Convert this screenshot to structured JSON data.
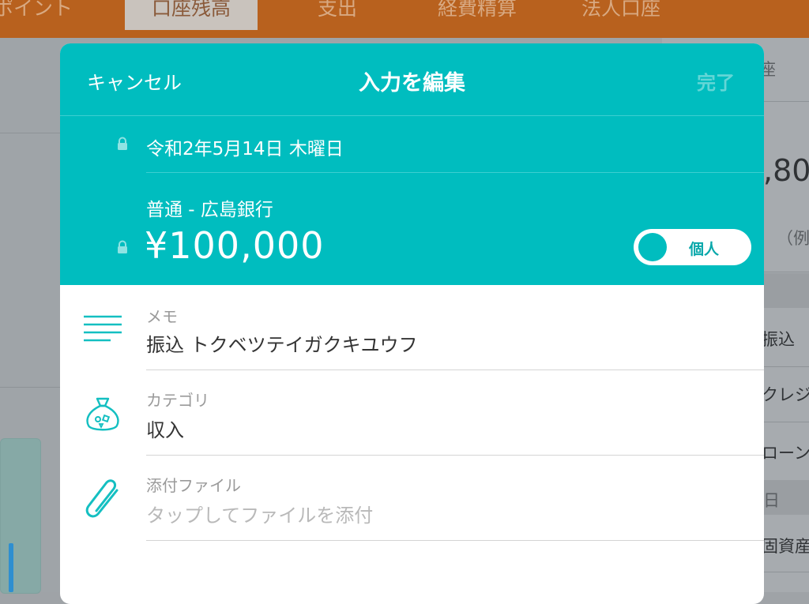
{
  "background": {
    "tabs": [
      "ポイント",
      "口座残高",
      "支出",
      "経費精算",
      "法人口座"
    ],
    "selected_tab": "口座残高",
    "right_panel": {
      "header_fragment": "座",
      "amount_fragment": ",80",
      "hint_fragment": "（例",
      "list_items": [
        "振込",
        "クレジ",
        "ローン"
      ],
      "section_fragment": "日",
      "footer_fragment": "固資産"
    }
  },
  "modal": {
    "cancel_label": "キャンセル",
    "title": "入力を編集",
    "done_label": "完了",
    "date": "令和2年5月14日 木曜日",
    "account": "普通 - 広島銀行",
    "amount": "¥100,000",
    "toggle_label": "個人",
    "fields": {
      "memo": {
        "label": "メモ",
        "value": "振込 トクベツテイガクキユウフ",
        "icon": "memo-lines-icon"
      },
      "category": {
        "label": "カテゴリ",
        "value": "収入",
        "icon": "money-bag-icon"
      },
      "attachment": {
        "label": "添付ファイル",
        "placeholder": "タップしてファイルを添付",
        "icon": "paperclip-icon"
      }
    }
  },
  "colors": {
    "accent": "#00bdbf",
    "tabbar": "#b8611e"
  }
}
